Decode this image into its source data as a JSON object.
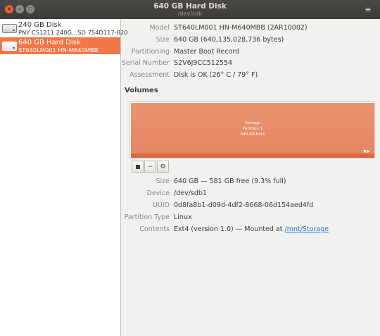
{
  "window": {
    "title": "640 GB Hard Disk",
    "subtitle": "/dev/sdb",
    "close_glyph": "×",
    "min_glyph": "–",
    "max_glyph": "□",
    "menu_glyph": "≡"
  },
  "disks": [
    {
      "name": "240 GB Disk",
      "desc": "PNY CS1211 240G…SD 754D117-820",
      "selected": false,
      "icon": "drive-icon"
    },
    {
      "name": "640 GB Hard Disk",
      "desc": "ST640LM001 HN-M640MBB",
      "selected": true,
      "icon": "drive-icon"
    }
  ],
  "drive_info": {
    "model_label": "Model",
    "model": "ST640LM001 HN-M640MBB (2AR10002)",
    "size_label": "Size",
    "size": "640 GB (640,135,028,736 bytes)",
    "partitioning_label": "Partitioning",
    "partitioning": "Master Boot Record",
    "serial_label": "Serial Number",
    "serial": "S2V6J9CC512554",
    "assessment_label": "Assessment",
    "assessment": "Disk is OK (26° C / 79° F)"
  },
  "volumes": {
    "title": "Volumes",
    "partition": {
      "line1": "Storage",
      "line2": "Partition 1",
      "line3": "640 GB Ext4",
      "status_glyph": "★▸"
    },
    "toolbar": {
      "stop_glyph": "■",
      "minus_glyph": "−",
      "settings_glyph": "⚙"
    }
  },
  "partition_info": {
    "size_label": "Size",
    "size": "640 GB — 581 GB free (9.3% full)",
    "device_label": "Device",
    "device": "/dev/sdb1",
    "uuid_label": "UUID",
    "uuid": "0d8fa8b1-d09d-4df2-8668-06d154aed4fd",
    "type_label": "Partition Type",
    "type": "Linux",
    "contents_label": "Contents",
    "contents_prefix": "Ext4 (version 1.0) — Mounted at ",
    "mount_link": "/mnt/Storage"
  },
  "colors": {
    "accent": "#f07746",
    "partition": "#e88a64",
    "link": "#2a76c6"
  }
}
